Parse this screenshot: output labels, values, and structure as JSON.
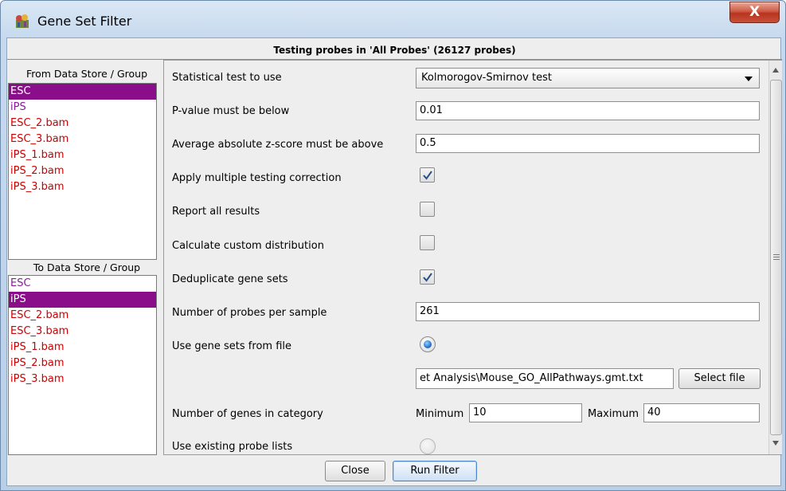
{
  "window": {
    "title": "Gene Set Filter",
    "close_glyph": "X"
  },
  "header": {
    "text": "Testing probes in 'All Probes' (26127 probes)"
  },
  "from_group": {
    "title": "From Data Store / Group",
    "items": [
      {
        "label": "ESC",
        "style": "selected"
      },
      {
        "label": "iPS",
        "style": "purple"
      },
      {
        "label": "ESC_2.bam",
        "style": "red"
      },
      {
        "label": "ESC_3.bam",
        "style": "red"
      },
      {
        "label": "iPS_1.bam",
        "style": "red"
      },
      {
        "label": "iPS_2.bam",
        "style": "red"
      },
      {
        "label": "iPS_3.bam",
        "style": "red"
      }
    ]
  },
  "to_group": {
    "title": "To Data Store / Group",
    "items": [
      {
        "label": "ESC",
        "style": "purple"
      },
      {
        "label": "iPS",
        "style": "selected"
      },
      {
        "label": "ESC_2.bam",
        "style": "red"
      },
      {
        "label": "ESC_3.bam",
        "style": "red"
      },
      {
        "label": "iPS_1.bam",
        "style": "red"
      },
      {
        "label": "iPS_2.bam",
        "style": "red"
      },
      {
        "label": "iPS_3.bam",
        "style": "red"
      }
    ]
  },
  "options": {
    "stat_test": {
      "label": "Statistical test to use",
      "value": "Kolmorogov-Smirnov test"
    },
    "pvalue": {
      "label": "P-value must be below",
      "value": "0.01"
    },
    "zscore": {
      "label": "Average absolute z-score must be above",
      "value": "0.5"
    },
    "multiple_testing": {
      "label": "Apply multiple testing correction",
      "checked": true
    },
    "report_all": {
      "label": "Report all results",
      "checked": false
    },
    "custom_distribution": {
      "label": "Calculate custom distribution",
      "checked": false
    },
    "deduplicate": {
      "label": "Deduplicate gene sets",
      "checked": true
    },
    "probes_per_sample": {
      "label": "Number of probes per sample",
      "value": "261"
    },
    "gene_sets_file": {
      "label": "Use gene sets from file",
      "selected": true
    },
    "file_path": {
      "value": "et Analysis\\Mouse_GO_AllPathways.gmt.txt",
      "button": "Select file"
    },
    "genes_in_category": {
      "label": "Number of genes in category",
      "min_label": "Minimum",
      "min_value": "10",
      "max_label": "Maximum",
      "max_value": "40"
    },
    "existing_lists": {
      "label": "Use existing probe lists",
      "selected": false
    }
  },
  "buttons": {
    "close": "Close",
    "run": "Run Filter"
  },
  "colors": {
    "selected_bg": "#8a0d8a",
    "store_red": "#cc0000",
    "group_purple": "#8a1a9a"
  }
}
